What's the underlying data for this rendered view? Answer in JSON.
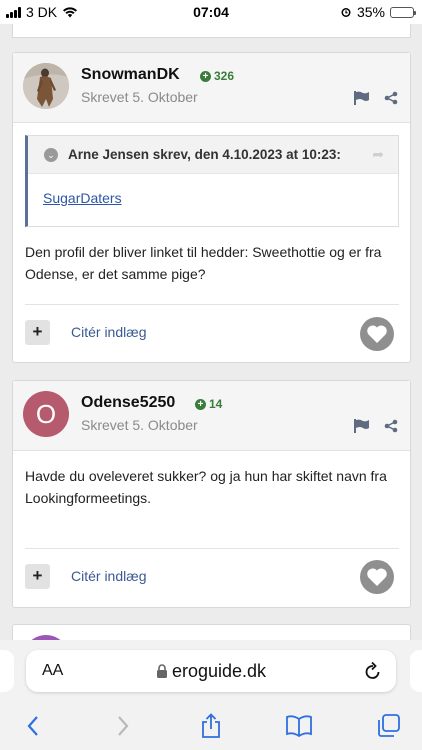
{
  "status_bar": {
    "carrier": "3 DK",
    "time": "07:04",
    "battery": "35%",
    "battery_level": 0.35,
    "icons": [
      "signal-icon",
      "wifi-icon",
      "alarm-icon",
      "battery-icon"
    ]
  },
  "posts": [
    {
      "username": "SnowmanDK",
      "reputation": "326",
      "posted": "Skrevet 5. Oktober",
      "quote": {
        "title": "Arne Jensen skrev, den 4.10.2023 at 10:23:",
        "link": "SugarDaters"
      },
      "text": "Den profil der bliver linket til hedder: Sweethottie og er fra Odense, er det samme pige?",
      "cite_label": "Citér indlæg",
      "plus_label": "+"
    },
    {
      "username": "Odense5250",
      "avatar_letter": "O",
      "reputation": "14",
      "posted": "Skrevet 5. Oktober",
      "text": "Havde du oveleveret sukker? og ja hun har skiftet navn fra Lookingformeetings.",
      "cite_label": "Citér indlæg",
      "plus_label": "+"
    }
  ],
  "browser": {
    "aa_label": "AA",
    "domain": "eroguide.dk"
  },
  "colors": {
    "accent_link": "#2c56a6",
    "reputation_green": "#3a7d3a",
    "avatar_o": "#b55b6d",
    "avatar_next": "#9b56b8",
    "battery_yellow": "#f3c316"
  }
}
